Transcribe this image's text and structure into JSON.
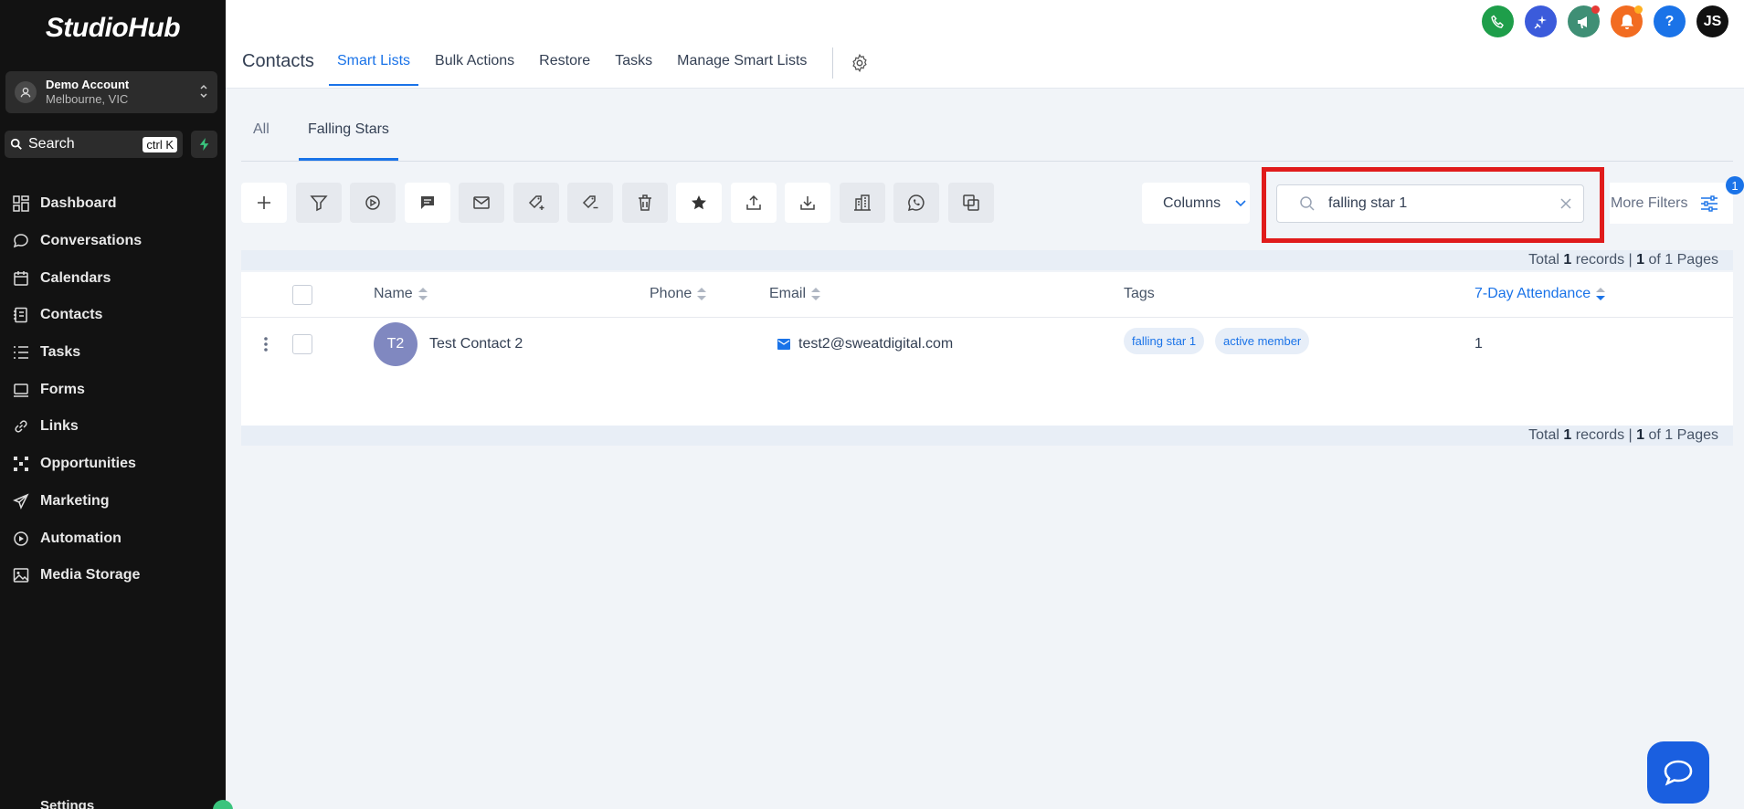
{
  "app": {
    "brand": "StudioHub"
  },
  "account": {
    "name": "Demo Account",
    "location": "Melbourne, VIC"
  },
  "sidebar_search": {
    "label": "Search",
    "shortcut": "ctrl K"
  },
  "nav": {
    "items": [
      {
        "label": "Dashboard",
        "icon": "dashboard-icon"
      },
      {
        "label": "Conversations",
        "icon": "chat-icon"
      },
      {
        "label": "Calendars",
        "icon": "calendar-icon"
      },
      {
        "label": "Contacts",
        "icon": "contacts-icon"
      },
      {
        "label": "Tasks",
        "icon": "tasks-icon"
      },
      {
        "label": "Forms",
        "icon": "forms-icon"
      },
      {
        "label": "Links",
        "icon": "link-icon"
      },
      {
        "label": "Opportunities",
        "icon": "opportunities-icon"
      },
      {
        "label": "Marketing",
        "icon": "send-icon"
      },
      {
        "label": "Automation",
        "icon": "automation-icon"
      },
      {
        "label": "Media Storage",
        "icon": "image-icon"
      }
    ],
    "settings_label": "Settings"
  },
  "header": {
    "title": "Contacts",
    "tabs": [
      {
        "label": "Smart Lists",
        "active": true
      },
      {
        "label": "Bulk Actions",
        "active": false
      },
      {
        "label": "Restore",
        "active": false
      },
      {
        "label": "Tasks",
        "active": false
      },
      {
        "label": "Manage Smart Lists",
        "active": false
      }
    ],
    "user_initials": "JS",
    "icon_colors": {
      "phone": "#1e9e4a",
      "sparkle": "#3b5bdb",
      "megaphone": "#3f8f75",
      "bell": "#f26c21",
      "help": "#1a73e8",
      "user": "#111111"
    }
  },
  "subtabs": [
    {
      "label": "All",
      "active": false
    },
    {
      "label": "Falling Stars",
      "active": true
    }
  ],
  "toolbar": {
    "columns_label": "Columns",
    "search_value": "falling star 1",
    "more_filters_label": "More Filters",
    "filter_badge": "1"
  },
  "table": {
    "totals_prefix": "Total ",
    "totals_records": "1",
    "totals_mid": " records | ",
    "totals_page": "1",
    "totals_suffix": " of 1 Pages",
    "columns": {
      "name": "Name",
      "phone": "Phone",
      "email": "Email",
      "tags": "Tags",
      "attendance": "7-Day Attendance"
    },
    "rows": [
      {
        "initials": "T2",
        "name": "Test Contact 2",
        "phone": "",
        "email": "test2@sweatdigital.com",
        "tags": [
          "falling star 1",
          "active member"
        ],
        "attendance": "1"
      }
    ]
  },
  "colors": {
    "accent": "#1a73e8",
    "sidebar_bg": "#121212",
    "highlight": "#e01b1b"
  }
}
